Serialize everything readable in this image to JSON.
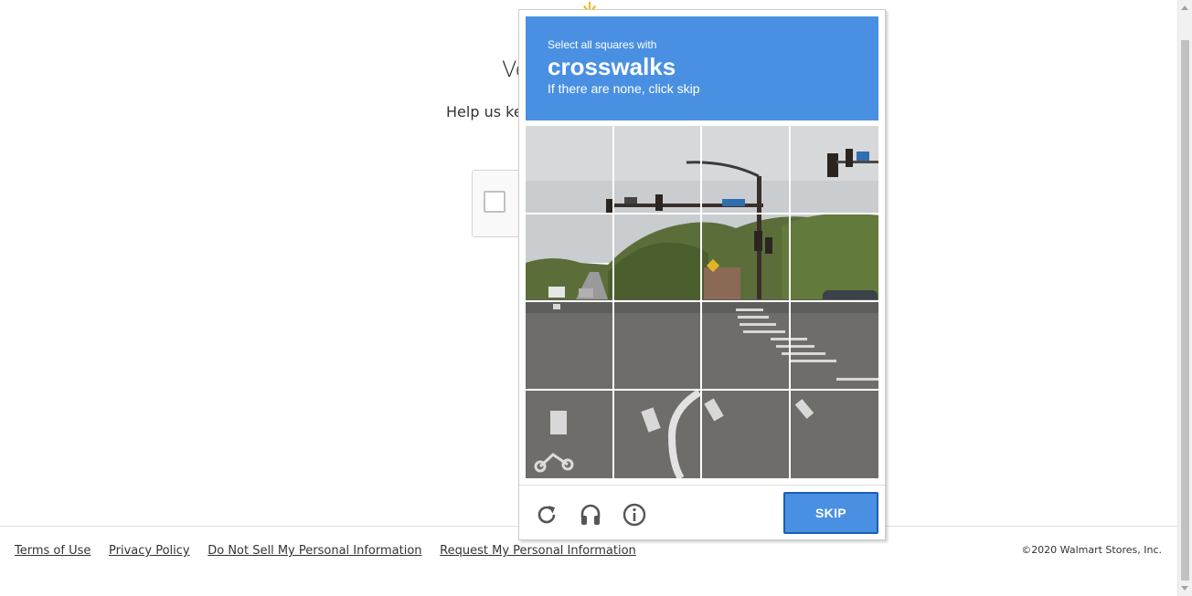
{
  "page": {
    "title_partial": "Ve",
    "subtitle_partial": "Help us kee"
  },
  "challenge": {
    "instruction_small": "Select all squares with",
    "instruction_object": "crosswalks",
    "instruction_hint": "If there are none, click skip",
    "grid": {
      "rows": 4,
      "cols": 4
    },
    "skip_label": "SKIP",
    "accent_color": "#4a90e2",
    "icons": [
      "reload-icon",
      "audio-icon",
      "info-icon"
    ]
  },
  "footer": {
    "links": [
      "Terms of Use",
      "Privacy Policy",
      "Do Not Sell My Personal Information",
      "Request My Personal Information"
    ],
    "copyright": "©2020 Walmart Stores, Inc."
  }
}
